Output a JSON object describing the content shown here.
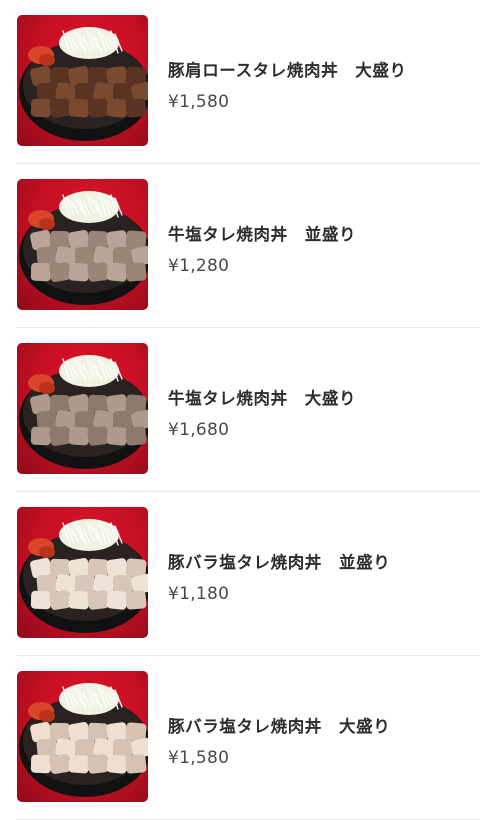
{
  "menu": {
    "items": [
      {
        "name": "豚肩ロースタレ焼肉丼　大盛り",
        "price": "¥1,580",
        "meat_color": "#5a3322",
        "meat_highlight": "#7a4a30",
        "image": "bowl-photo"
      },
      {
        "name": "牛塩タレ焼肉丼　並盛り",
        "price": "¥1,280",
        "meat_color": "#9a8577",
        "meat_highlight": "#b9a597",
        "image": "bowl-photo"
      },
      {
        "name": "牛塩タレ焼肉丼　大盛り",
        "price": "¥1,680",
        "meat_color": "#8e7a6c",
        "meat_highlight": "#ae9a8c",
        "image": "bowl-photo"
      },
      {
        "name": "豚バラ塩タレ焼肉丼　並盛り",
        "price": "¥1,180",
        "meat_color": "#d8c6b8",
        "meat_highlight": "#efe2d6",
        "image": "bowl-photo"
      },
      {
        "name": "豚バラ塩タレ焼肉丼　大盛り",
        "price": "¥1,580",
        "meat_color": "#d6c2b2",
        "meat_highlight": "#eedfd2",
        "image": "bowl-photo"
      }
    ]
  },
  "colors": {
    "background": "#ffffff",
    "divider": "#e6e6e6",
    "thumb_red": "#c30f22",
    "cabbage": "#eef3e4",
    "bowl": "#111111",
    "kimchi": "#d8452a"
  }
}
